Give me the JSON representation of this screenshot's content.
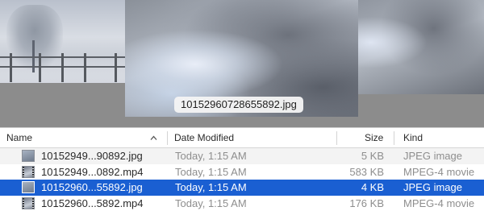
{
  "preview": {
    "caption": "10152960728655892.jpg"
  },
  "columns": {
    "name": "Name",
    "date_modified": "Date Modified",
    "size": "Size",
    "kind": "Kind"
  },
  "files": [
    {
      "name": "10152949...90892.jpg",
      "date": "Today, 1:15 AM",
      "size": "5 KB",
      "kind": "JPEG image",
      "icon": "jpeg-file-icon",
      "selected": false
    },
    {
      "name": "10152949...0892.mp4",
      "date": "Today, 1:15 AM",
      "size": "583 KB",
      "kind": "MPEG-4 movie",
      "icon": "movie-file-icon",
      "selected": false
    },
    {
      "name": "10152960...55892.jpg",
      "date": "Today, 1:15 AM",
      "size": "4 KB",
      "kind": "JPEG image",
      "icon": "jpeg-file-icon",
      "selected": true
    },
    {
      "name": "10152960...5892.mp4",
      "date": "Today, 1:15 AM",
      "size": "176 KB",
      "kind": "MPEG-4 movie",
      "icon": "movie-file-icon",
      "selected": false
    }
  ],
  "colors": {
    "selection": "#1a5fd2",
    "alt_row": "#f3f3f3",
    "coverflow_bg": "#8c8c8c"
  }
}
